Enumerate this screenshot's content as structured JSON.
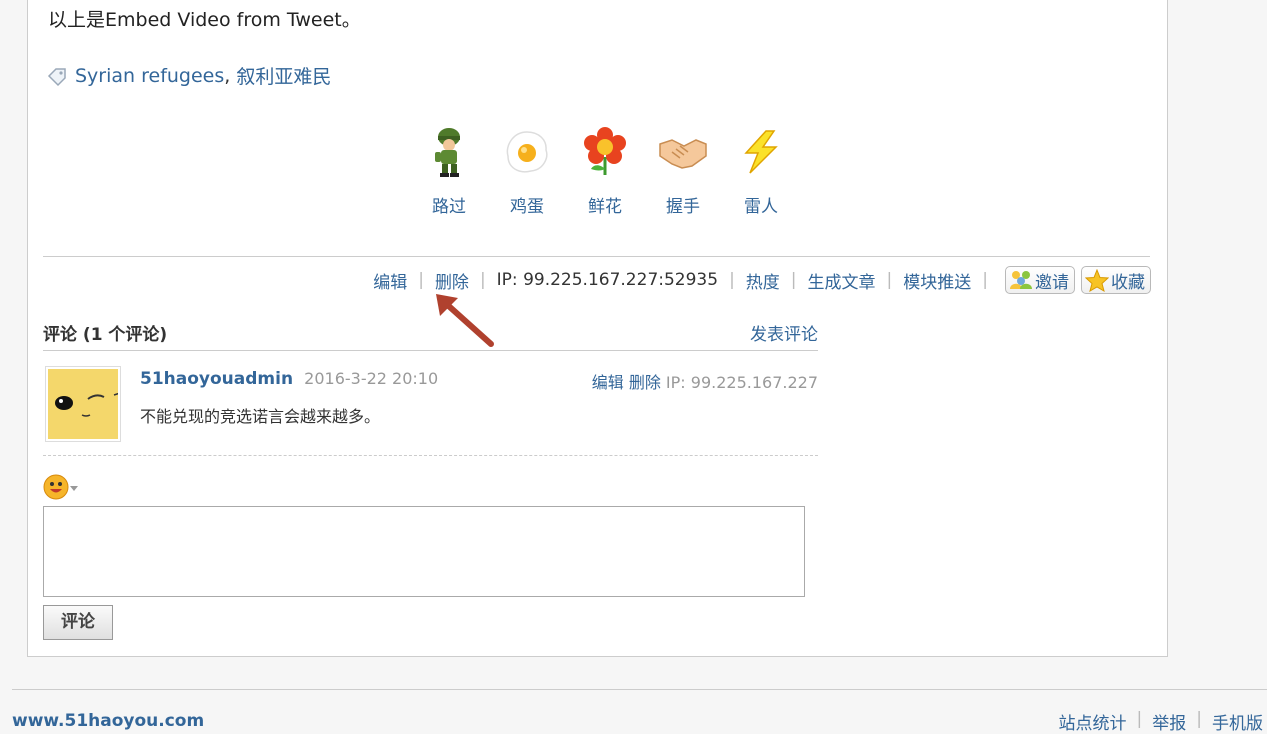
{
  "intro_text": "以上是Embed Video from Tweet。",
  "tags": {
    "items": [
      "Syrian refugees",
      "叙利亚难民"
    ],
    "separator": ", "
  },
  "reactions": [
    {
      "label": "路过",
      "icon": "soldier-icon"
    },
    {
      "label": "鸡蛋",
      "icon": "fried-egg-icon"
    },
    {
      "label": "鲜花",
      "icon": "flower-icon"
    },
    {
      "label": "握手",
      "icon": "handshake-icon"
    },
    {
      "label": "雷人",
      "icon": "lightning-icon"
    }
  ],
  "post_actions": {
    "edit": "编辑",
    "delete": "删除",
    "ip": "IP: 99.225.167.227:52935",
    "heat": "热度",
    "generate_article": "生成文章",
    "module_push": "模块推送",
    "invite": "邀请",
    "favorite": "收藏"
  },
  "comments": {
    "title": "评论 (1 个评论)",
    "post_comment_link": "发表评论",
    "items": [
      {
        "user": "51haoyouadmin",
        "time": "2016-3-22 20:10",
        "edit": "编辑",
        "delete": "删除",
        "ip": "IP: 99.225.167.227",
        "text": "不能兑现的竞选诺言会越来越多。"
      }
    ]
  },
  "editor": {
    "submit_label": "评论"
  },
  "footer": {
    "site": "www.51haoyou.com",
    "links": [
      "站点统计",
      "举报",
      "手机版"
    ]
  },
  "colors": {
    "link": "#336699",
    "annotation_arrow": "#b0412e"
  }
}
